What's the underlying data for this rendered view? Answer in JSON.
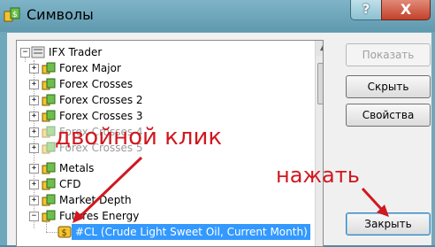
{
  "window": {
    "title": "Символы",
    "help_glyph": "?",
    "close_glyph": "X"
  },
  "tree": {
    "root": "IFX Trader",
    "items": [
      {
        "label": "Forex Major",
        "expander": "+"
      },
      {
        "label": "Forex Crosses",
        "expander": "+"
      },
      {
        "label": "Forex Crosses 2",
        "expander": "+"
      },
      {
        "label": "Forex Crosses 3",
        "expander": "+"
      },
      {
        "label": "Forex Crosses 4",
        "expander": "+"
      },
      {
        "label": "Forex Crosses 5",
        "expander": "+"
      },
      {
        "label": "Metals",
        "expander": "+"
      },
      {
        "label": "CFD",
        "expander": "+"
      },
      {
        "label": "Market Depth",
        "expander": "+"
      },
      {
        "label": "Futures Energy",
        "expander": "−"
      }
    ],
    "selected_symbol": "#CL  (Crude Light Sweet Oil, Current Month)"
  },
  "buttons": {
    "show": "Показать",
    "hide": "Скрыть",
    "properties": "Свойства",
    "close": "Закрыть"
  },
  "annotations": {
    "double_click": "двойной клик",
    "press": "нажать",
    "color": "#d0181f"
  }
}
